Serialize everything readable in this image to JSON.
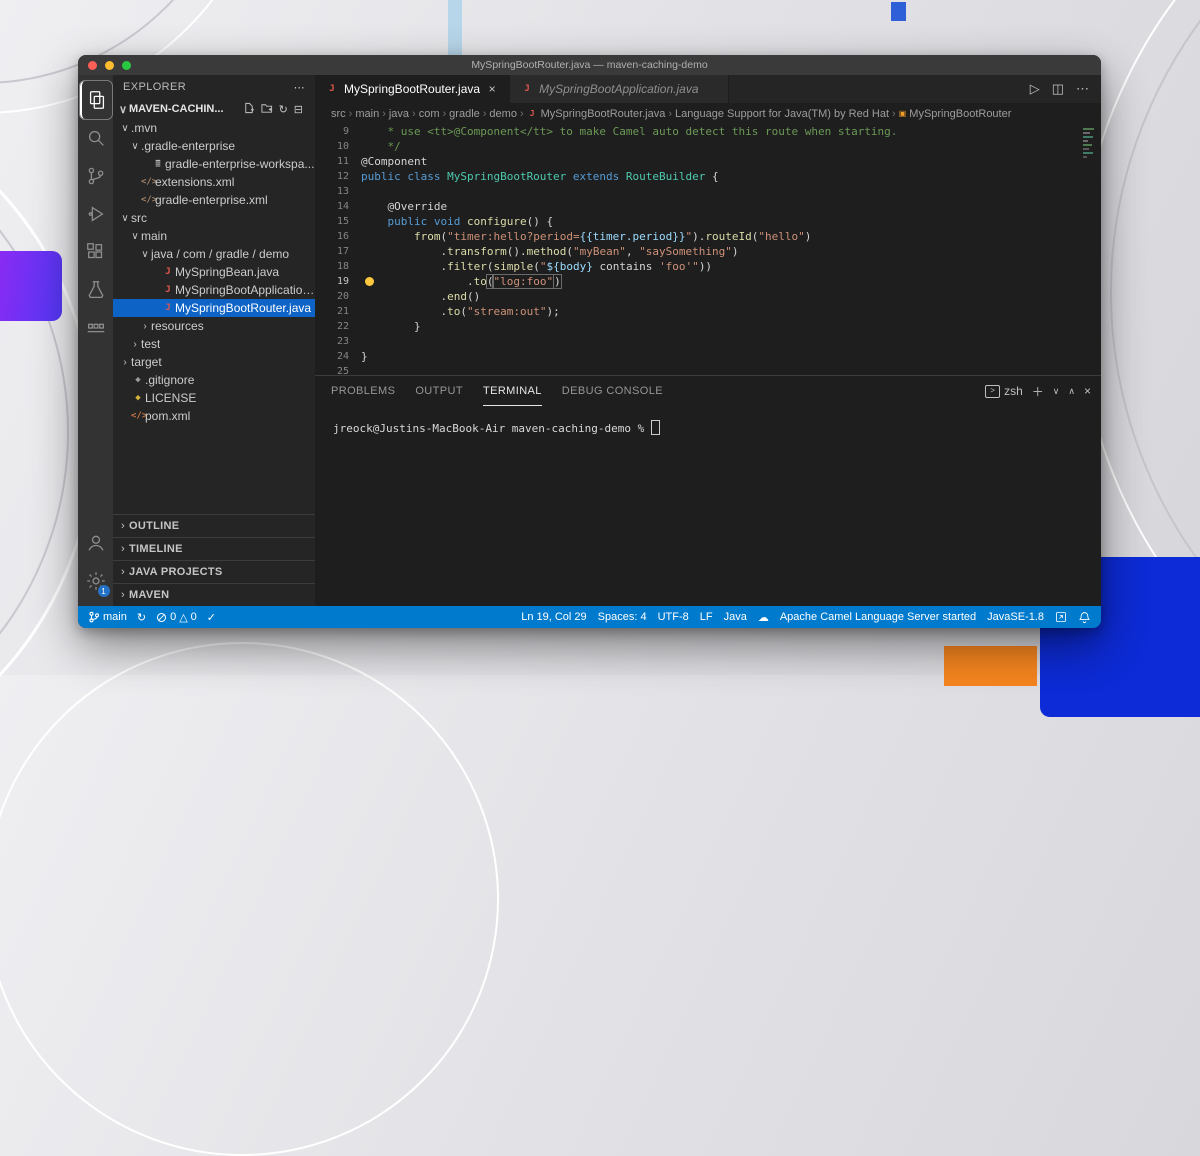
{
  "window_title": "MySpringBootRouter.java — maven-caching-demo",
  "activity_bar": {
    "settings_badge": "1"
  },
  "explorer": {
    "title": "EXPLORER",
    "workspace": "MAVEN-CACHIN...",
    "tree": [
      {
        "label": ".mvn",
        "level": 0,
        "arrow": "open",
        "icon": "folder"
      },
      {
        "label": ".gradle-enterprise",
        "level": 1,
        "arrow": "open",
        "icon": "folder"
      },
      {
        "label": "gradle-enterprise-workspa...",
        "level": 2,
        "icon": "settings-file"
      },
      {
        "label": "extensions.xml",
        "level": 1,
        "icon": "xml"
      },
      {
        "label": "gradle-enterprise.xml",
        "level": 1,
        "icon": "xml"
      },
      {
        "label": "src",
        "level": 0,
        "arrow": "open",
        "icon": "folder"
      },
      {
        "label": "main",
        "level": 1,
        "arrow": "open",
        "icon": "folder"
      },
      {
        "label": "java / com / gradle / demo",
        "level": 2,
        "arrow": "open",
        "icon": "folder"
      },
      {
        "label": "MySpringBean.java",
        "level": 3,
        "icon": "java"
      },
      {
        "label": "MySpringBootApplication....",
        "level": 3,
        "icon": "java"
      },
      {
        "label": "MySpringBootRouter.java",
        "level": 3,
        "icon": "java",
        "selected": true
      },
      {
        "label": "resources",
        "level": 2,
        "arrow": "closed",
        "icon": "folder"
      },
      {
        "label": "test",
        "level": 1,
        "arrow": "closed",
        "icon": "folder"
      },
      {
        "label": "target",
        "level": 0,
        "arrow": "closed",
        "icon": "folder"
      },
      {
        "label": ".gitignore",
        "level": 0,
        "icon": "git"
      },
      {
        "label": "LICENSE",
        "level": 0,
        "icon": "license"
      },
      {
        "label": "pom.xml",
        "level": 0,
        "icon": "xml-brown"
      }
    ],
    "sections": [
      "OUTLINE",
      "TIMELINE",
      "JAVA PROJECTS",
      "MAVEN"
    ]
  },
  "tabs": [
    {
      "label": "MySpringBootRouter.java",
      "active": true,
      "icon": "java"
    },
    {
      "label": "MySpringBootApplication.java",
      "active": false,
      "preview": true,
      "icon": "java"
    }
  ],
  "breadcrumbs": [
    {
      "label": "src"
    },
    {
      "label": "main"
    },
    {
      "label": "java"
    },
    {
      "label": "com"
    },
    {
      "label": "gradle"
    },
    {
      "label": "demo"
    },
    {
      "label": "MySpringBootRouter.java",
      "icon": "java"
    },
    {
      "label": "Language Support for Java(TM) by Red Hat"
    },
    {
      "label": "MySpringBootRouter",
      "icon": "symbol"
    }
  ],
  "editor": {
    "lines": [
      {
        "n": "9",
        "t": [
          [
            "com",
            "    * use <tt>@Component</tt> to make Camel auto detect this route when starting."
          ]
        ]
      },
      {
        "n": "10",
        "t": [
          [
            "com",
            "    */"
          ]
        ]
      },
      {
        "n": "11",
        "t": [
          [
            "plain",
            "@Component"
          ]
        ]
      },
      {
        "n": "12",
        "t": [
          [
            "kw",
            "public class "
          ],
          [
            "type",
            "MySpringBootRouter"
          ],
          [
            "kw",
            " extends "
          ],
          [
            "type",
            "RouteBuilder"
          ],
          [
            "plain",
            " {"
          ]
        ]
      },
      {
        "n": "13",
        "t": []
      },
      {
        "n": "14",
        "t": [
          [
            "plain",
            "    @Override"
          ]
        ]
      },
      {
        "n": "15",
        "t": [
          [
            "kw",
            "    public void "
          ],
          [
            "fn",
            "configure"
          ],
          [
            "plain",
            "() {"
          ]
        ]
      },
      {
        "n": "16",
        "t": [
          [
            "plain",
            "        "
          ],
          [
            "fn",
            "from"
          ],
          [
            "plain",
            "("
          ],
          [
            "str",
            "\"timer:hello?period="
          ],
          [
            "var",
            "{{timer.period}}"
          ],
          [
            "str",
            "\""
          ],
          [
            "plain",
            ")."
          ],
          [
            "fn",
            "routeId"
          ],
          [
            "plain",
            "("
          ],
          [
            "str",
            "\"hello\""
          ],
          [
            "plain",
            ")"
          ]
        ]
      },
      {
        "n": "17",
        "t": [
          [
            "plain",
            "            ."
          ],
          [
            "fn",
            "transform"
          ],
          [
            "plain",
            "()."
          ],
          [
            "fn",
            "method"
          ],
          [
            "plain",
            "("
          ],
          [
            "str",
            "\"myBean\""
          ],
          [
            "plain",
            ", "
          ],
          [
            "str",
            "\"saySomething\""
          ],
          [
            "plain",
            ")"
          ]
        ]
      },
      {
        "n": "18",
        "t": [
          [
            "plain",
            "            ."
          ],
          [
            "fn",
            "filter"
          ],
          [
            "plain",
            "("
          ],
          [
            "fn",
            "simple"
          ],
          [
            "plain",
            "("
          ],
          [
            "str",
            "\""
          ],
          [
            "var",
            "${body}"
          ],
          [
            "plain",
            " contains "
          ],
          [
            "str",
            "'foo'\""
          ],
          [
            "plain",
            "))"
          ]
        ]
      },
      {
        "n": "19",
        "bulb": true,
        "active": true,
        "t": [
          [
            "plain",
            "                ."
          ],
          [
            "fn",
            "to"
          ],
          [
            "plain hl",
            "("
          ],
          [
            "str hl",
            "\"log:foo\""
          ],
          [
            "caret",
            ""
          ],
          [
            "plain hl",
            ")"
          ]
        ]
      },
      {
        "n": "20",
        "t": [
          [
            "plain",
            "            ."
          ],
          [
            "fn",
            "end"
          ],
          [
            "plain",
            "()"
          ]
        ]
      },
      {
        "n": "21",
        "t": [
          [
            "plain",
            "            ."
          ],
          [
            "fn",
            "to"
          ],
          [
            "plain",
            "("
          ],
          [
            "str",
            "\"stream:out\""
          ],
          [
            "plain",
            ");"
          ]
        ]
      },
      {
        "n": "22",
        "t": [
          [
            "plain",
            "        }"
          ]
        ]
      },
      {
        "n": "23",
        "t": []
      },
      {
        "n": "24",
        "t": [
          [
            "plain",
            "}"
          ]
        ]
      },
      {
        "n": "25",
        "t": []
      }
    ]
  },
  "panel": {
    "tabs": [
      {
        "label": "PROBLEMS"
      },
      {
        "label": "OUTPUT"
      },
      {
        "label": "TERMINAL",
        "active": true
      },
      {
        "label": "DEBUG CONSOLE"
      }
    ],
    "shell_label": "zsh",
    "prompt": "jreock@Justins-MacBook-Air maven-caching-demo %"
  },
  "status_bar": {
    "branch": "main",
    "errors": "0",
    "warnings": "0",
    "check": "✓",
    "right": [
      {
        "name": "cursor-position",
        "label": "Ln 19, Col 29"
      },
      {
        "name": "indentation",
        "label": "Spaces: 4"
      },
      {
        "name": "encoding",
        "label": "UTF-8"
      },
      {
        "name": "eol",
        "label": "LF"
      },
      {
        "name": "language-mode",
        "label": "Java"
      },
      {
        "name": "cloud",
        "icon": "cloud"
      },
      {
        "name": "camel-status",
        "label": "Apache Camel Language Server started"
      },
      {
        "name": "java-version",
        "label": "JavaSE-1.8"
      },
      {
        "name": "remote",
        "icon": "remote"
      },
      {
        "name": "notifications",
        "icon": "bell"
      }
    ]
  }
}
